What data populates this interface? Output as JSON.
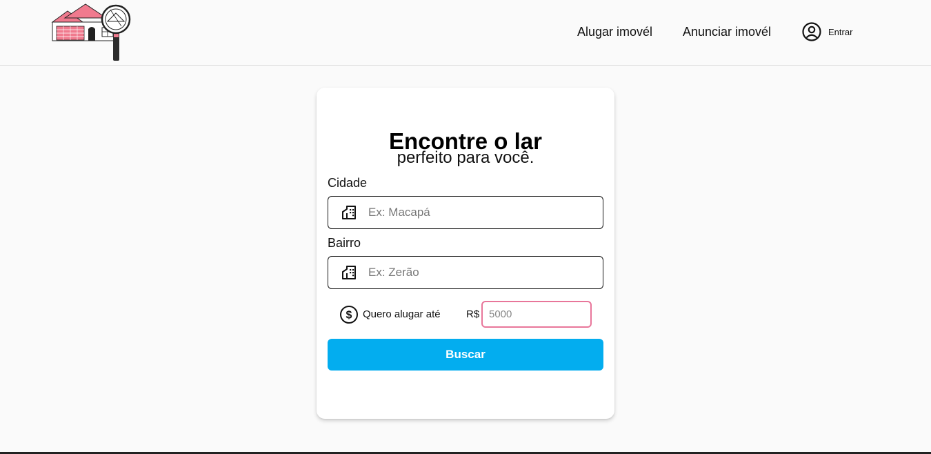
{
  "header": {
    "logo_icon": "house-magnifier-logo",
    "nav": {
      "rent_label": "Alugar imovél",
      "announce_label": "Anunciar imovél"
    },
    "login": {
      "icon": "user-circle-icon",
      "label": "Entrar"
    }
  },
  "search_card": {
    "title": "Encontre o lar",
    "subtitle": "perfeito para você.",
    "city": {
      "label": "Cidade",
      "icon": "building-icon",
      "placeholder": "Ex: Macapá",
      "value": ""
    },
    "district": {
      "label": "Bairro",
      "icon": "building-icon",
      "placeholder": "Ex: Zerão",
      "value": ""
    },
    "price": {
      "icon": "dollar-circle-icon",
      "label": "Quero alugar até",
      "currency": "R$",
      "placeholder": "5000",
      "value": ""
    },
    "search_button_label": "Buscar"
  },
  "colors": {
    "background": "#fafafa",
    "primary_button": "#03adef",
    "accent_pink": "#e8769a",
    "logo_pink": "#f07a8e"
  }
}
